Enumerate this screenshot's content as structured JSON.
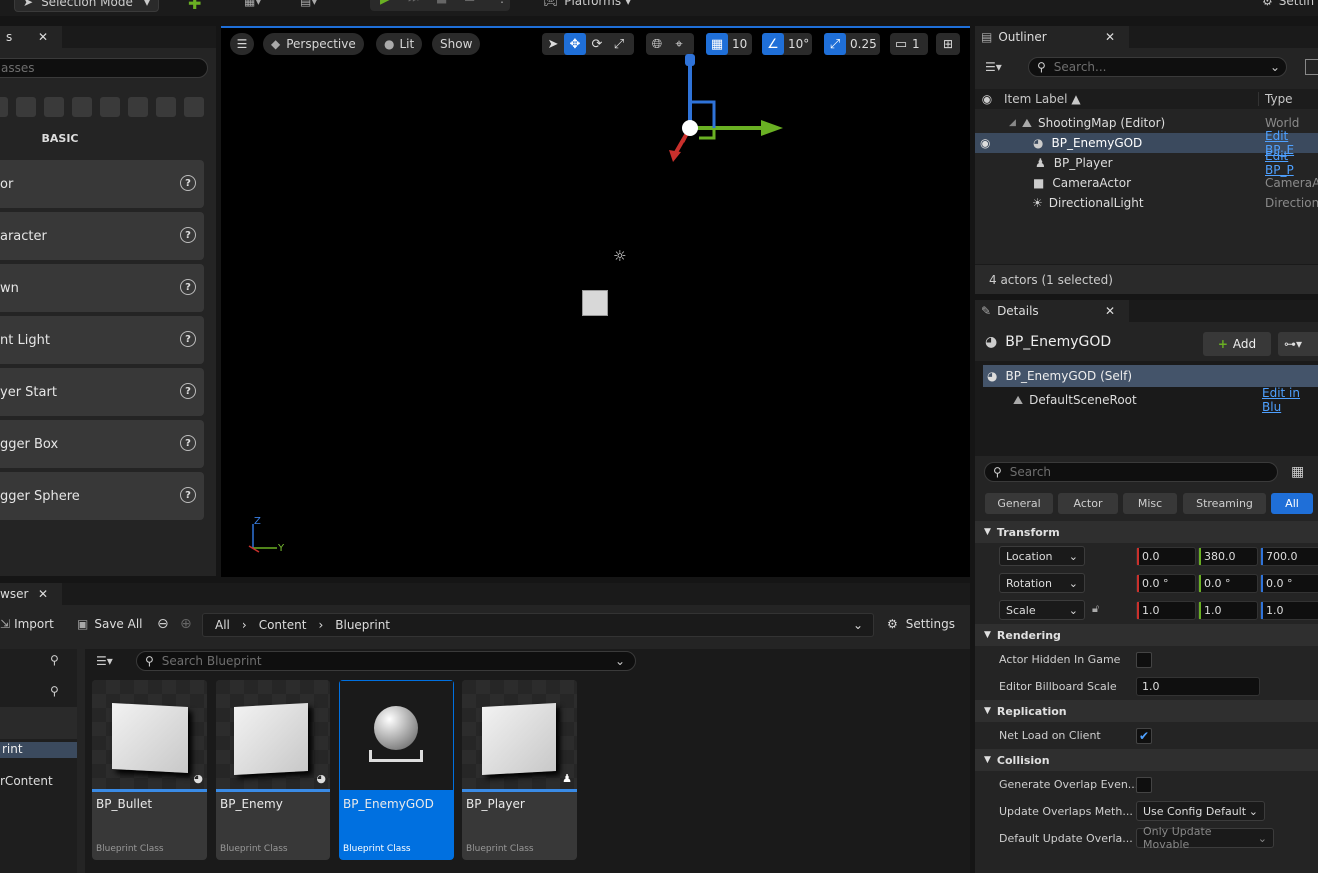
{
  "toolbar": {
    "selection_mode": "Selection Mode",
    "platforms": "Platforms",
    "settings": "Settin"
  },
  "place_actors": {
    "tab": "s",
    "search_placeholder": "asses",
    "category": "BASIC",
    "items": [
      {
        "label": "or"
      },
      {
        "label": "aracter"
      },
      {
        "label": "wn"
      },
      {
        "label": "nt Light"
      },
      {
        "label": "yer Start"
      },
      {
        "label": "gger Box"
      },
      {
        "label": "gger Sphere"
      }
    ]
  },
  "viewport": {
    "perspective": "Perspective",
    "lit": "Lit",
    "show": "Show",
    "grid": "10",
    "angle": "10°",
    "scale": "0.25",
    "camera_speed": "1",
    "axis_z": "Z",
    "axis_y": "Y"
  },
  "outliner": {
    "tab": "Outliner",
    "search_placeholder": "Search...",
    "col_label": "Item Label ▲",
    "col_type": "Type",
    "rows": [
      {
        "label": "ShootingMap (Editor)",
        "type": "World"
      },
      {
        "label": "BP_EnemyGOD",
        "type": "Edit BP_E"
      },
      {
        "label": "BP_Player",
        "type": "Edit BP_P"
      },
      {
        "label": "CameraActor",
        "type": "CameraA"
      },
      {
        "label": "DirectionalLight",
        "type": "Direction"
      }
    ],
    "status": "4 actors (1 selected)"
  },
  "details": {
    "tab": "Details",
    "title": "BP_EnemyGOD",
    "add": "Add",
    "self": "BP_EnemyGOD (Self)",
    "root": "DefaultSceneRoot",
    "edit_in": "Edit in Blu",
    "search_placeholder": "Search",
    "filters": [
      "General",
      "Actor",
      "Misc",
      "Streaming",
      "All"
    ],
    "transform": "Transform",
    "location": {
      "label": "Location",
      "x": "0.0",
      "y": "380.0",
      "z": "700.0"
    },
    "rotation": {
      "label": "Rotation",
      "x": "0.0 °",
      "y": "0.0 °",
      "z": "0.0 °"
    },
    "scale": {
      "label": "Scale",
      "x": "1.0",
      "y": "1.0",
      "z": "1.0"
    },
    "rendering": "Rendering",
    "actor_hidden": "Actor Hidden In Game",
    "billboard": "Editor Billboard Scale",
    "billboard_val": "1.0",
    "replication": "Replication",
    "net_load": "Net Load on Client",
    "collision": "Collision",
    "gen_overlap": "Generate Overlap Even...",
    "update_overlaps": "Update Overlaps Meth...",
    "update_overlaps_val": "Use Config Default",
    "default_update": "Default Update Overla...",
    "default_update_val": "Only Update Movable"
  },
  "content_browser": {
    "tab": "wser",
    "import": "Import",
    "save_all": "Save All",
    "path": [
      "All",
      "Content",
      "Blueprint"
    ],
    "settings": "Settings",
    "search_placeholder": "Search Blueprint",
    "folders": [
      "rint",
      "rContent"
    ],
    "assets": [
      {
        "name": "BP_Bullet",
        "type": "Blueprint Class"
      },
      {
        "name": "BP_Enemy",
        "type": "Blueprint Class"
      },
      {
        "name": "BP_EnemyGOD",
        "type": "Blueprint Class"
      },
      {
        "name": "BP_Player",
        "type": "Blueprint Class"
      }
    ]
  },
  "colors": {
    "accent": "#1f6fd8",
    "link": "#4ea0ff",
    "axis_x": "#c9302c",
    "axis_y": "#6ab023",
    "axis_z": "#2f73d9"
  }
}
